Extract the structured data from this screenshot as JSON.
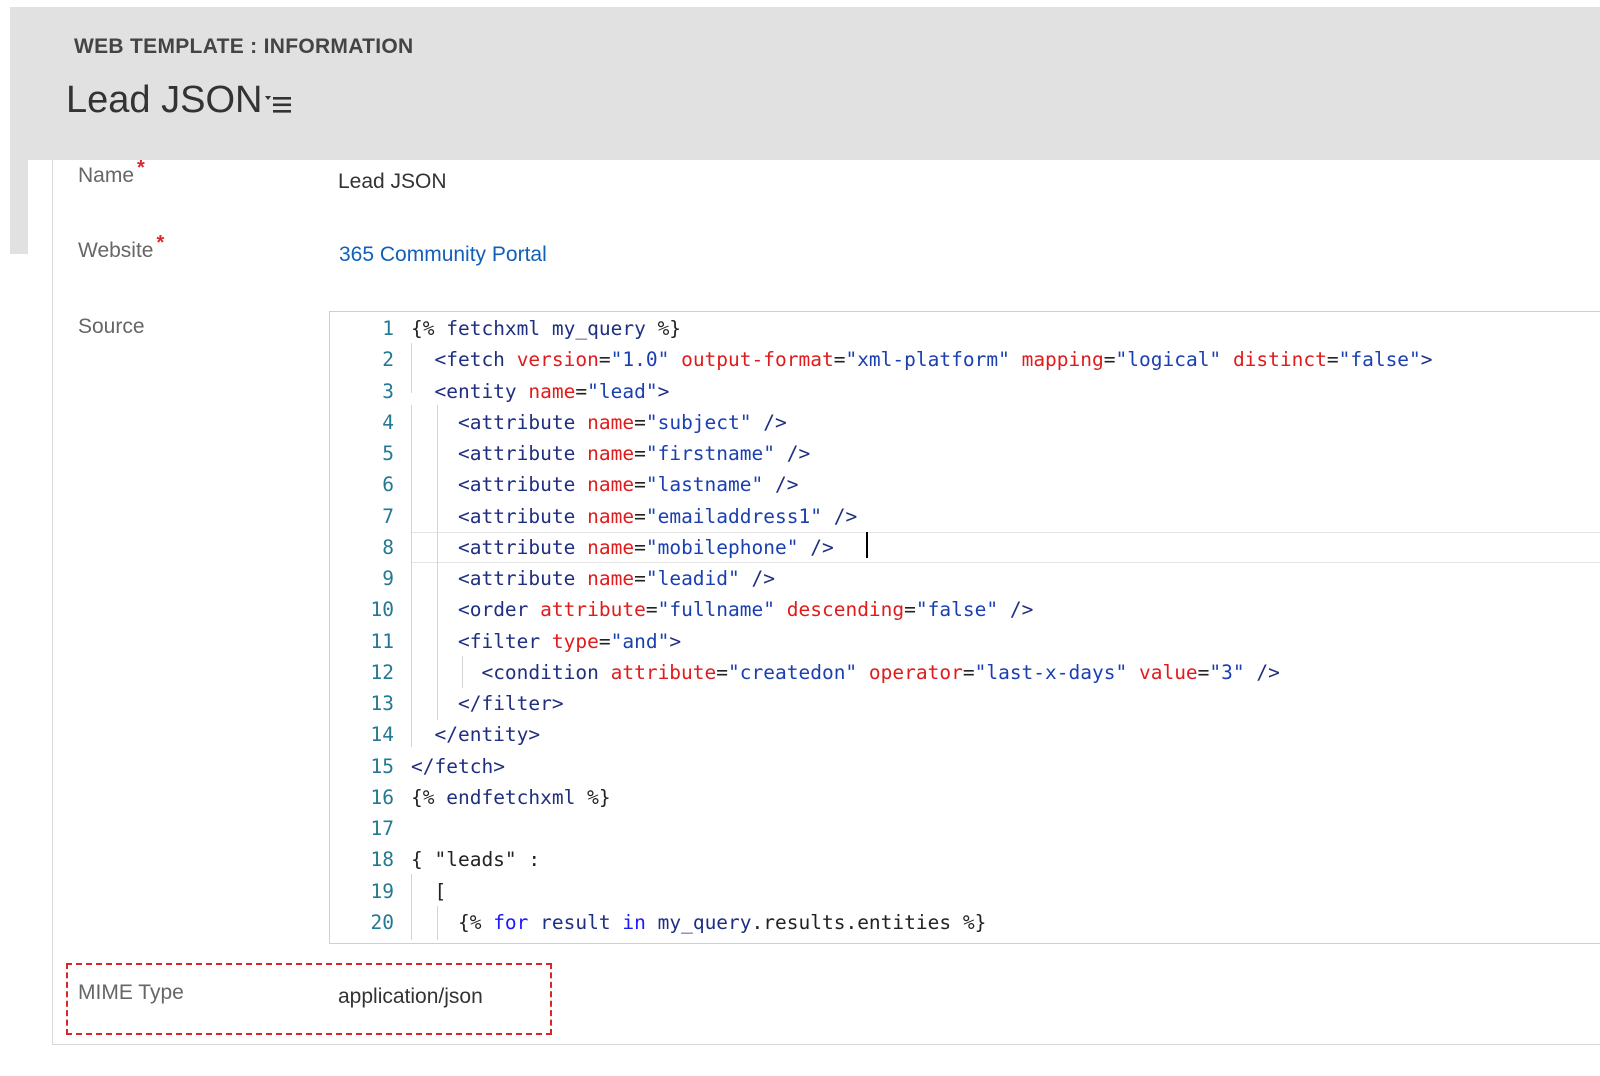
{
  "header": {
    "entity_label": "WEB TEMPLATE : INFORMATION",
    "record_title": "Lead JSON"
  },
  "fields": {
    "name": {
      "label": "Name",
      "required_mark": "*",
      "value": "Lead JSON"
    },
    "website": {
      "label": "Website",
      "required_mark": "*",
      "value": "365 Community Portal"
    },
    "source": {
      "label": "Source"
    },
    "mime_type": {
      "label": "MIME Type",
      "value": "application/json"
    }
  },
  "code_lines": [
    {
      "n": "1",
      "text": "{% fetchxml my_query %}"
    },
    {
      "n": "2",
      "text": "  <fetch version=\"1.0\" output-format=\"xml-platform\" mapping=\"logical\" distinct=\"false\">"
    },
    {
      "n": "3",
      "text": "  <entity name=\"lead\">"
    },
    {
      "n": "4",
      "text": "    <attribute name=\"subject\" />"
    },
    {
      "n": "5",
      "text": "    <attribute name=\"firstname\" />"
    },
    {
      "n": "6",
      "text": "    <attribute name=\"lastname\" />"
    },
    {
      "n": "7",
      "text": "    <attribute name=\"emailaddress1\" />"
    },
    {
      "n": "8",
      "text": "    <attribute name=\"mobilephone\" />"
    },
    {
      "n": "9",
      "text": "    <attribute name=\"leadid\" />"
    },
    {
      "n": "10",
      "text": "    <order attribute=\"fullname\" descending=\"false\" />"
    },
    {
      "n": "11",
      "text": "    <filter type=\"and\">"
    },
    {
      "n": "12",
      "text": "      <condition attribute=\"createdon\" operator=\"last-x-days\" value=\"3\" />"
    },
    {
      "n": "13",
      "text": "    </filter>"
    },
    {
      "n": "14",
      "text": "  </entity>"
    },
    {
      "n": "15",
      "text": "</fetch>"
    },
    {
      "n": "16",
      "text": "{% endfetchxml %}"
    },
    {
      "n": "17",
      "text": ""
    },
    {
      "n": "18",
      "text": "{ \"leads\" :"
    },
    {
      "n": "19",
      "text": "  ["
    },
    {
      "n": "20",
      "text": "    {% for result in my_query.results.entities %}"
    }
  ],
  "colors": {
    "header_bg": "#e1e1e1",
    "required": "#d8262a",
    "link": "#1160b7",
    "line_number": "#237893",
    "code_tag": "#1f2f80",
    "code_attr": "#e01b1b",
    "code_string": "#1a3fb0",
    "code_keyword": "#1a1aff",
    "highlight_border": "#d8262a"
  }
}
